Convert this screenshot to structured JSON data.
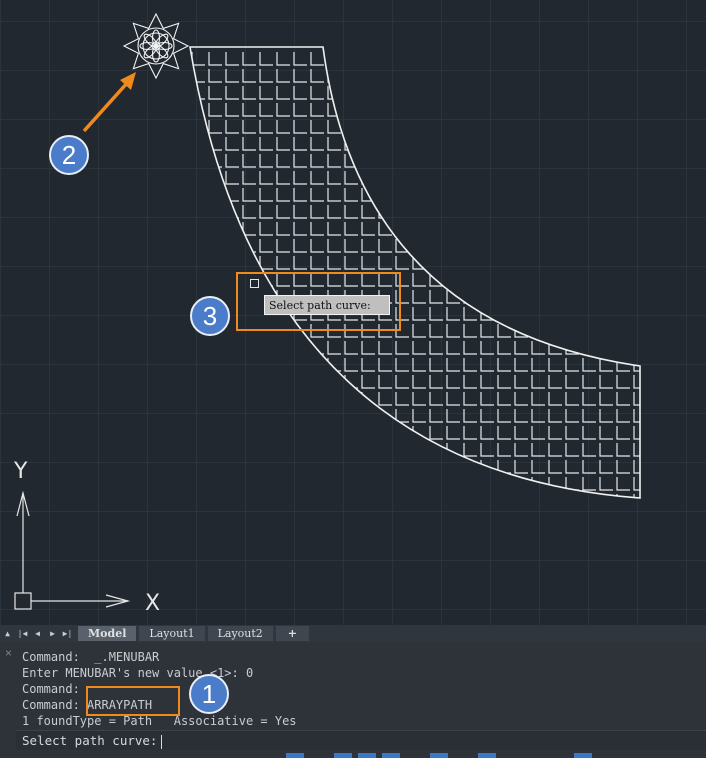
{
  "tabs": {
    "items": [
      {
        "label": "Model",
        "active": true
      },
      {
        "label": "Layout1",
        "active": false
      },
      {
        "label": "Layout2",
        "active": false
      },
      {
        "label": "+",
        "active": false
      }
    ]
  },
  "canvas": {
    "tooltip": "Select path curve:",
    "ucs": {
      "x_label": "X",
      "y_label": "Y"
    }
  },
  "callouts": {
    "one": "1",
    "two": "2",
    "three": "3"
  },
  "command_line": {
    "close_icon": "×",
    "history": [
      "Command:  _.MENUBAR",
      "Enter MENUBAR's new value <1>: 0",
      "Command:",
      "Command: ARRAYPATH",
      "1 foundType = Path   Associative = Yes"
    ],
    "prompt": "Select path curve:"
  },
  "colors": {
    "canvas_bg": "#212830",
    "callout": "#4a7cc9",
    "highlight": "#f08a1c"
  }
}
